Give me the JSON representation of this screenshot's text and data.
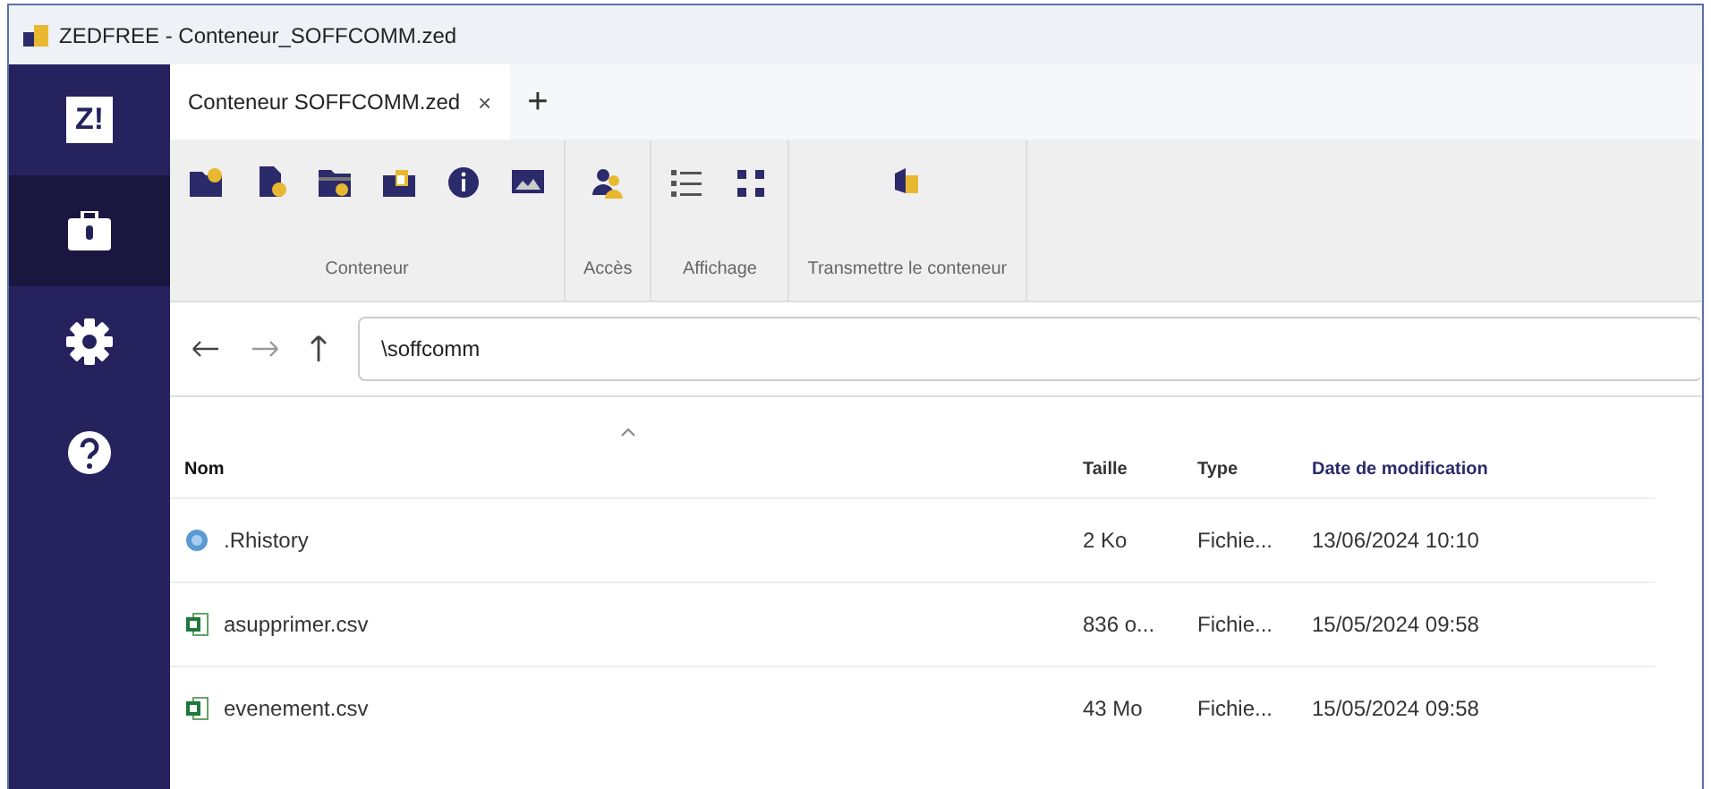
{
  "window": {
    "title": "ZEDFREE - Conteneur_SOFFCOMM.zed"
  },
  "sidebar": {
    "items": [
      {
        "kind": "logo",
        "label": "Z!",
        "selected": false
      },
      {
        "kind": "briefcase",
        "selected": true
      },
      {
        "kind": "settings",
        "selected": false
      },
      {
        "kind": "help",
        "selected": false
      }
    ]
  },
  "tabs": [
    {
      "label": "Conteneur SOFFCOMM.zed",
      "selected": true,
      "close": "×"
    }
  ],
  "new_tab": "+",
  "toolbar": {
    "groups": [
      {
        "label": "Conteneur",
        "buttons": [
          {
            "kind": "foldernew"
          },
          {
            "kind": "filekey"
          },
          {
            "kind": "folderkey"
          },
          {
            "kind": "folderlock"
          },
          {
            "kind": "info"
          },
          {
            "kind": "image"
          }
        ]
      },
      {
        "label": "Accès",
        "buttons": [
          {
            "kind": "users"
          }
        ]
      },
      {
        "label": "Affichage",
        "buttons": [
          {
            "kind": "list"
          },
          {
            "kind": "grid"
          }
        ]
      },
      {
        "label": "Transmettre le conteneur",
        "buttons": [
          {
            "kind": "send"
          }
        ]
      }
    ]
  },
  "nav": {
    "path": "\\soffcomm"
  },
  "table": {
    "columns": [
      {
        "label": "Nom",
        "sorted": true
      },
      {
        "label": "Taille",
        "sorted": false
      },
      {
        "label": "Type",
        "sorted": false
      },
      {
        "label": "Date de modification",
        "sorted": false
      }
    ],
    "rows": [
      {
        "kind": "r",
        "cells": [
          ".Rhistory",
          "2 Ko",
          "Fichie...",
          "13/06/2024 10:10"
        ]
      },
      {
        "kind": "csv",
        "cells": [
          "asupprimer.csv",
          "836 o...",
          "Fichie...",
          "15/05/2024 09:58"
        ]
      },
      {
        "kind": "csv",
        "cells": [
          "evenement.csv",
          "43 Mo",
          "Fichie...",
          "15/05/2024 09:58"
        ]
      }
    ]
  }
}
